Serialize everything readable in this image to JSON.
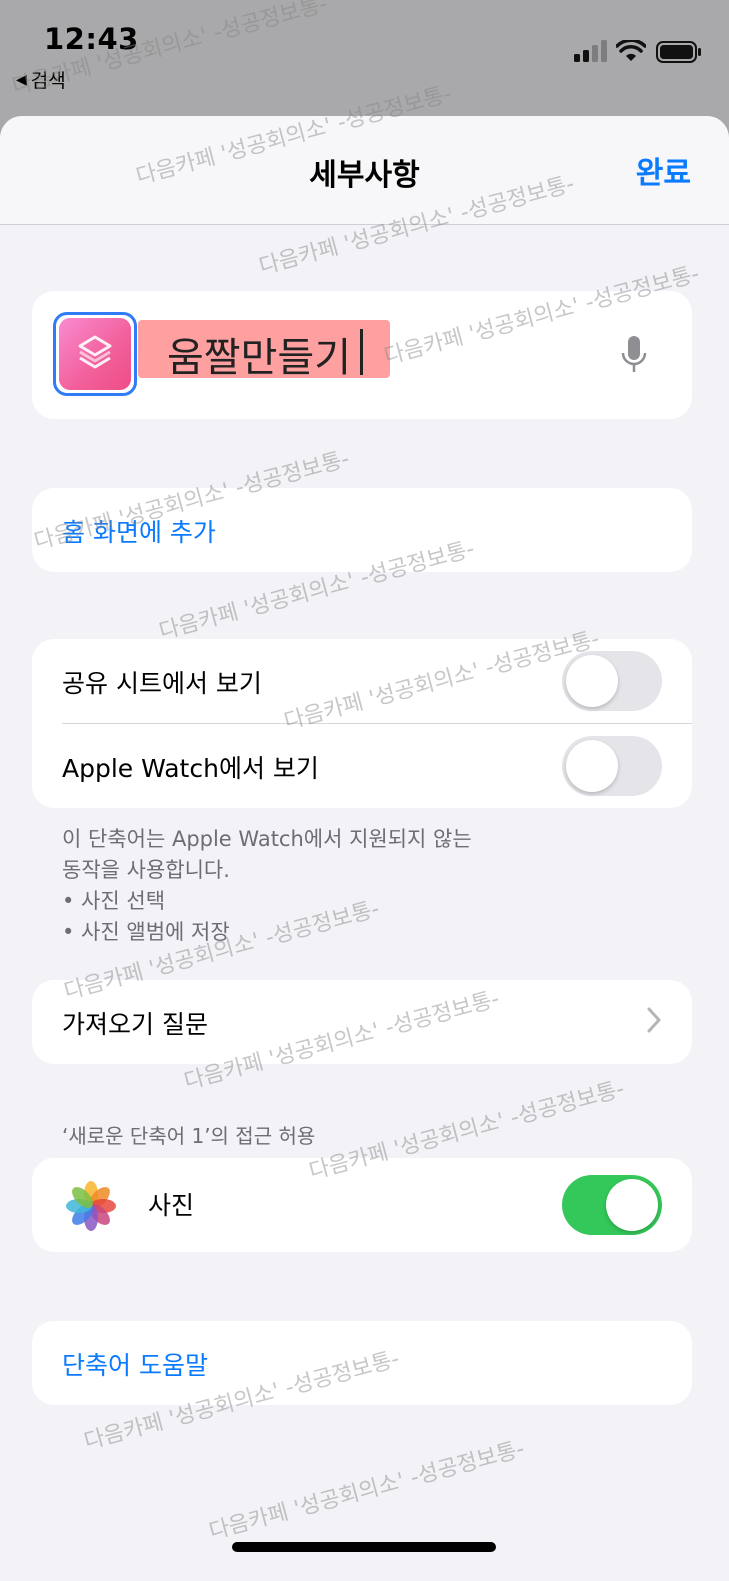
{
  "status_bar": {
    "time": "12:43",
    "back_label": "검색"
  },
  "nav": {
    "title": "세부사항",
    "done_label": "완료"
  },
  "shortcut": {
    "name": "움짤만들기",
    "icon": "shortcuts-icon",
    "icon_colors": [
      "#f98bd0",
      "#ee4d86"
    ]
  },
  "home_card": {
    "add_to_home_label": "홈 화면에 추가"
  },
  "toggles": {
    "share_sheet_label": "공유 시트에서 보기",
    "share_sheet_on": false,
    "apple_watch_label": "Apple Watch에서 보기",
    "apple_watch_on": false
  },
  "watch_note": {
    "line1": "이 단축어는 Apple Watch에서 지원되지 않는",
    "line2": "동작을 사용합니다.",
    "bullet1": "• 사진 선택",
    "bullet2": "• 사진 앨범에 저장"
  },
  "import_card": {
    "import_questions_label": "가져오기 질문"
  },
  "access": {
    "header": "‘새로운 단축어 1’의 접근 허용",
    "photos_label": "사진",
    "photos_on": true
  },
  "help_card": {
    "help_label": "단축어 도움말"
  },
  "watermark": {
    "text": "다음카페 '성공회의소' -성공정보통-"
  },
  "colors": {
    "accent": "#0a7aff",
    "toggle_on": "#34c759",
    "sheet_bg": "#f2f2f7"
  }
}
